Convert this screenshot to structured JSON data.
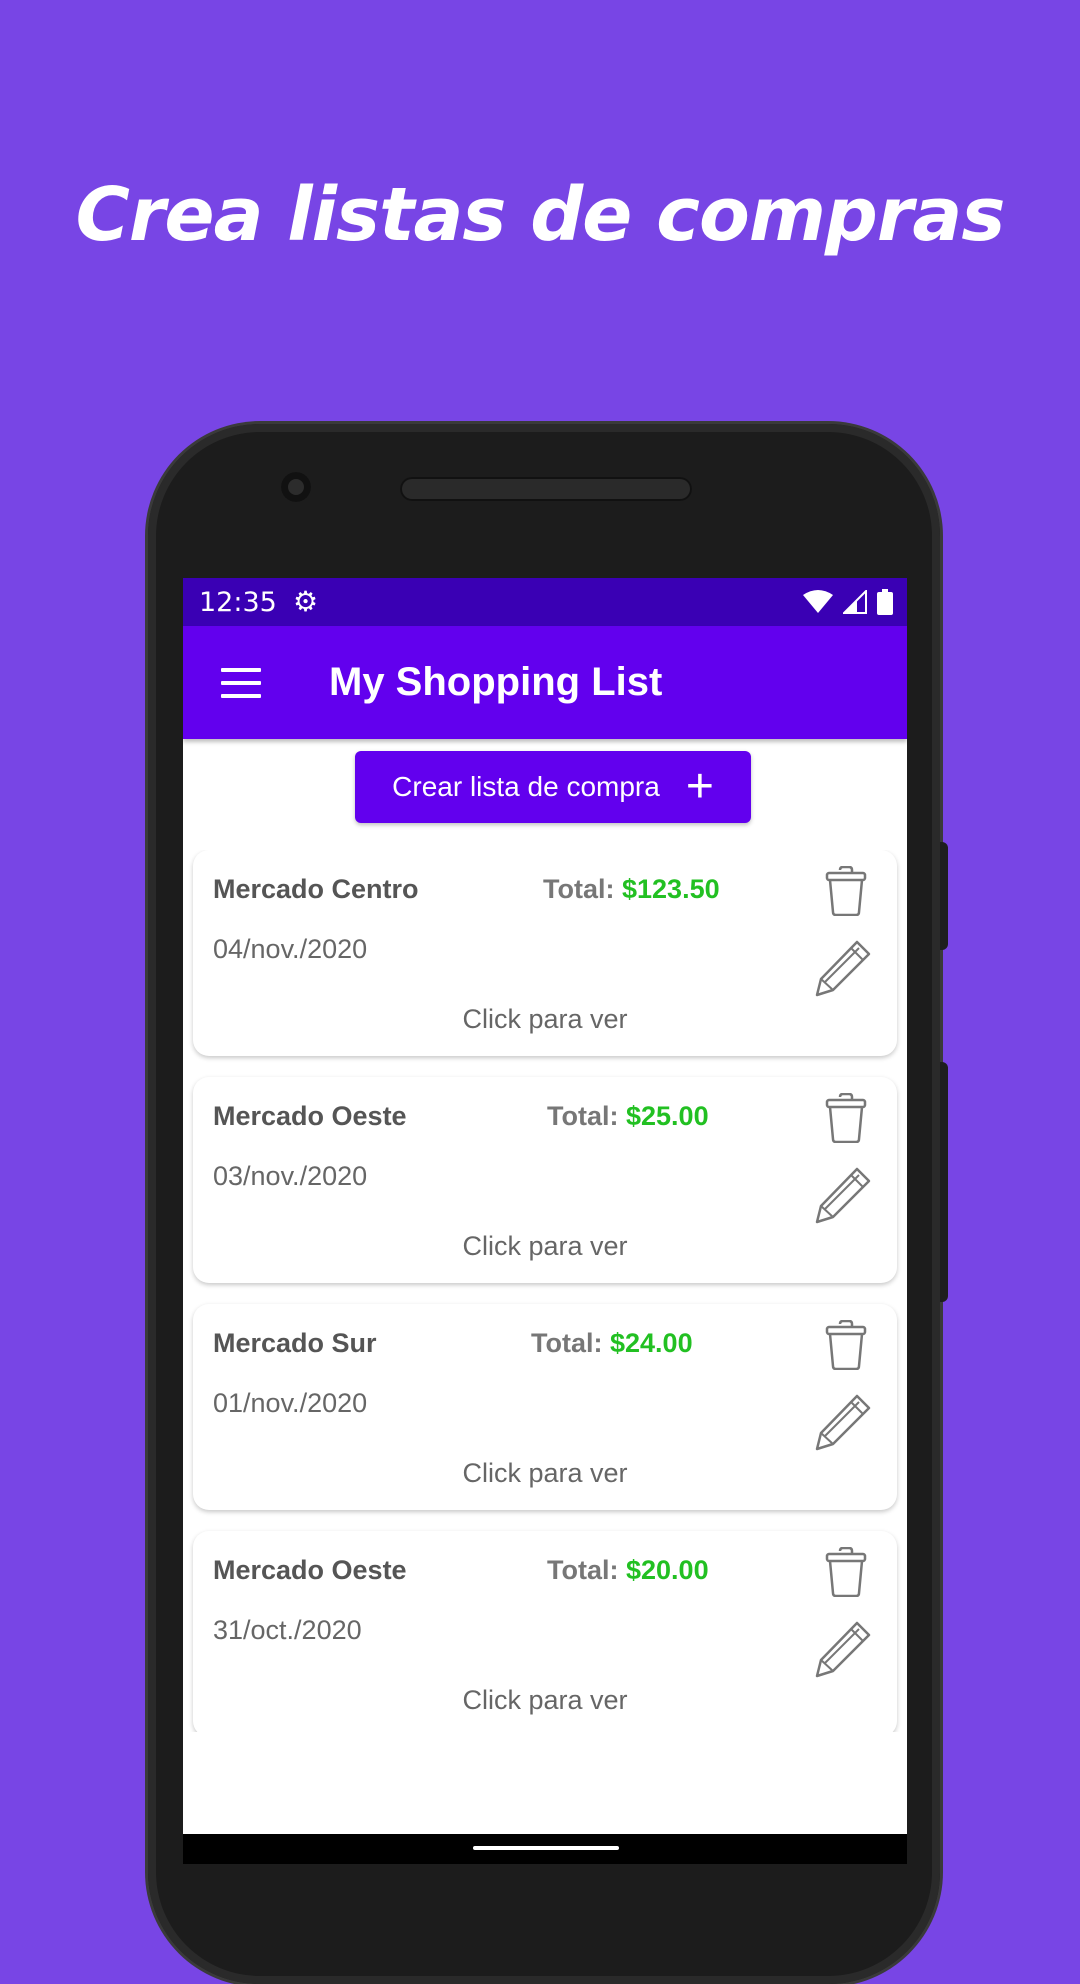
{
  "headline": "Crea listas de compras",
  "status_bar": {
    "time": "12:35"
  },
  "app_bar": {
    "title": "My Shopping List"
  },
  "create_button": {
    "label": "Crear lista de compra",
    "icon": "plus-icon"
  },
  "total_label": "Total:",
  "click_label": "Click para ver",
  "lists": [
    {
      "market": "Mercado Centro",
      "total": "$123.50",
      "date": "04/nov./2020"
    },
    {
      "market": "Mercado Oeste",
      "total": "$25.00",
      "date": "03/nov./2020"
    },
    {
      "market": "Mercado Sur",
      "total": "$24.00",
      "date": "01/nov./2020"
    },
    {
      "market": "Mercado Oeste",
      "total": "$20.00",
      "date": "31/oct./2020"
    }
  ],
  "colors": {
    "background": "#7845E5",
    "primary": "#6200EE",
    "status_bar": "#3A00B4",
    "total_amount": "#22C022"
  }
}
